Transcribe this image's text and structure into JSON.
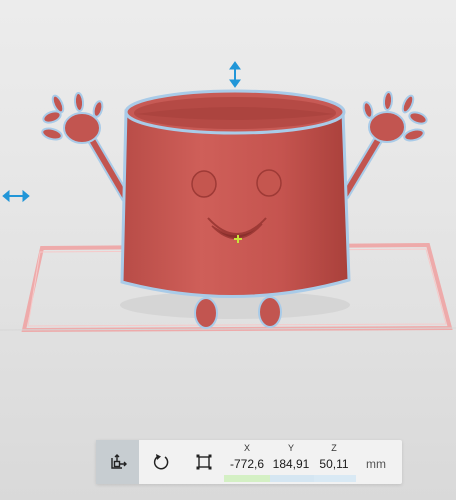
{
  "viewport": {
    "model": "smiling cup with raised hands",
    "colors": {
      "model": "#c25550",
      "model_dark": "#9e3a36",
      "outline": "#a9cbe8",
      "plate": "#ee8c8c",
      "gizmo": "#2196d8",
      "background": "#e8e8e8"
    }
  },
  "toolbar": {
    "tools": [
      {
        "name": "move",
        "icon": "move-icon",
        "active": true
      },
      {
        "name": "rotate",
        "icon": "rotate-icon",
        "active": false
      },
      {
        "name": "scale",
        "icon": "scale-icon",
        "active": false
      }
    ],
    "coords": {
      "x_label": "X",
      "x_value": "-772,6",
      "y_label": "Y",
      "y_value": "184,91",
      "z_label": "Z",
      "z_value": "50,11",
      "unit": "mm"
    },
    "axis_colors": {
      "x": "#d4f0c4",
      "y": "#d5e6f2",
      "z": "#d9e9f4"
    }
  }
}
